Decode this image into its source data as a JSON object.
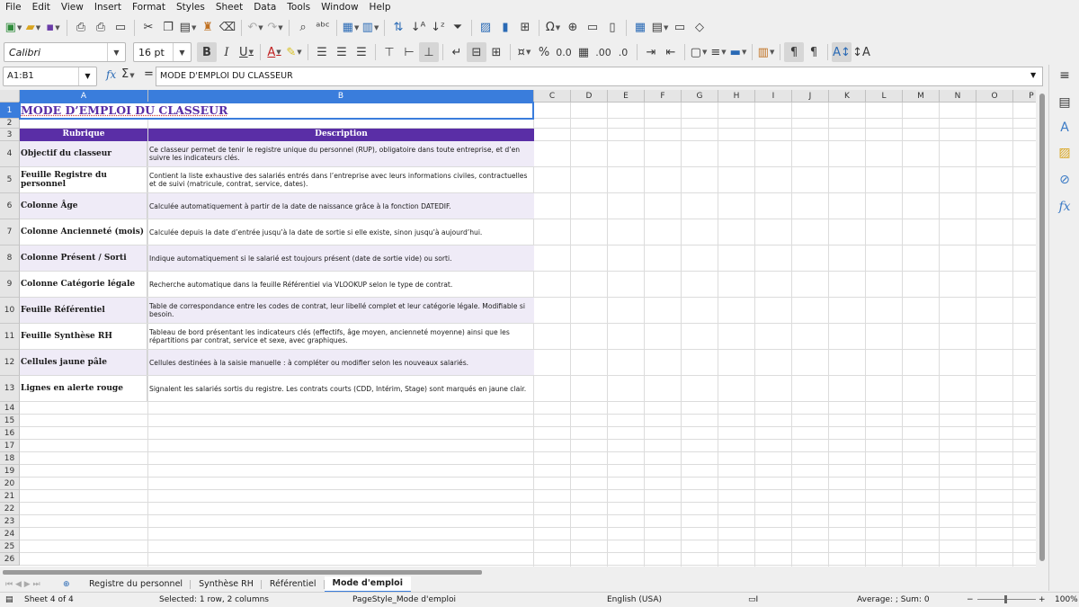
{
  "menu": [
    "File",
    "Edit",
    "View",
    "Insert",
    "Format",
    "Styles",
    "Sheet",
    "Data",
    "Tools",
    "Window",
    "Help"
  ],
  "font": {
    "name": "Calibri",
    "size": "16 pt"
  },
  "name_box": "A1:B1",
  "formula": "MODE D'EMPLOI DU CLASSEUR",
  "columns": [
    "A",
    "B",
    "C",
    "D",
    "E",
    "F",
    "G",
    "H",
    "I",
    "J",
    "K",
    "L",
    "M",
    "N",
    "O",
    "P"
  ],
  "rows": [
    "1",
    "2",
    "3",
    "4",
    "5",
    "6",
    "7",
    "8",
    "9",
    "10",
    "11",
    "12",
    "13",
    "14",
    "15",
    "16",
    "17",
    "18",
    "19",
    "20",
    "21",
    "22",
    "23",
    "24",
    "25",
    "26"
  ],
  "sheet": {
    "title": "MODE D’EMPLOI DU CLASSEUR",
    "header": {
      "rubrique": "Rubrique",
      "description": "Description"
    },
    "items": [
      {
        "rubrique": "Objectif du classeur",
        "description": "Ce classeur permet de tenir le registre unique du personnel (RUP), obligatoire dans toute entreprise, et d’en suivre les indicateurs clés."
      },
      {
        "rubrique": "Feuille Registre du personnel",
        "description": "Contient la liste exhaustive des salariés entrés dans l’entreprise avec leurs informations civiles, contractuelles et de suivi (matricule, contrat, service, dates)."
      },
      {
        "rubrique": "Colonne Âge",
        "description": "Calculée automatiquement à partir de la date de naissance grâce à la fonction DATEDIF."
      },
      {
        "rubrique": "Colonne Ancienneté (mois)",
        "description": "Calculée depuis la date d’entrée jusqu’à la date de sortie si elle existe, sinon jusqu’à aujourd’hui."
      },
      {
        "rubrique": "Colonne Présent / Sorti",
        "description": "Indique automatiquement si le salarié est toujours présent (date de sortie vide) ou sorti."
      },
      {
        "rubrique": "Colonne Catégorie légale",
        "description": "Recherche automatique dans la feuille Référentiel via VLOOKUP selon le type de contrat."
      },
      {
        "rubrique": "Feuille Référentiel",
        "description": "Table de correspondance entre les codes de contrat, leur libellé complet et leur catégorie légale. Modifiable si besoin."
      },
      {
        "rubrique": "Feuille Synthèse RH",
        "description": "Tableau de bord présentant les indicateurs clés (effectifs, âge moyen, ancienneté moyenne) ainsi que les répartitions par contrat, service et sexe, avec graphiques."
      },
      {
        "rubrique": "Cellules jaune pâle",
        "description": "Cellules destinées à la saisie manuelle : à compléter ou modifier selon les nouveaux salariés."
      },
      {
        "rubrique": "Lignes en alerte rouge",
        "description": "Signalent les salariés sortis du registre. Les contrats courts (CDD, Intérim, Stage) sont marqués en jaune clair."
      }
    ]
  },
  "tabs": [
    "Registre du personnel",
    "Synthèse RH",
    "Référentiel",
    "Mode d'emploi"
  ],
  "active_tab": "Mode d'emploi",
  "status": {
    "sheet": "Sheet 4 of 4",
    "selection": "Selected: 1 row, 2 columns",
    "page_style": "PageStyle_Mode d'emploi",
    "language": "English (USA)",
    "sum": "Average: ; Sum: 0",
    "zoom": "100%"
  },
  "colors": {
    "header_purple": "#5a2ea6",
    "row_shade": "#efebf7",
    "selection": "#3a7ddc"
  }
}
